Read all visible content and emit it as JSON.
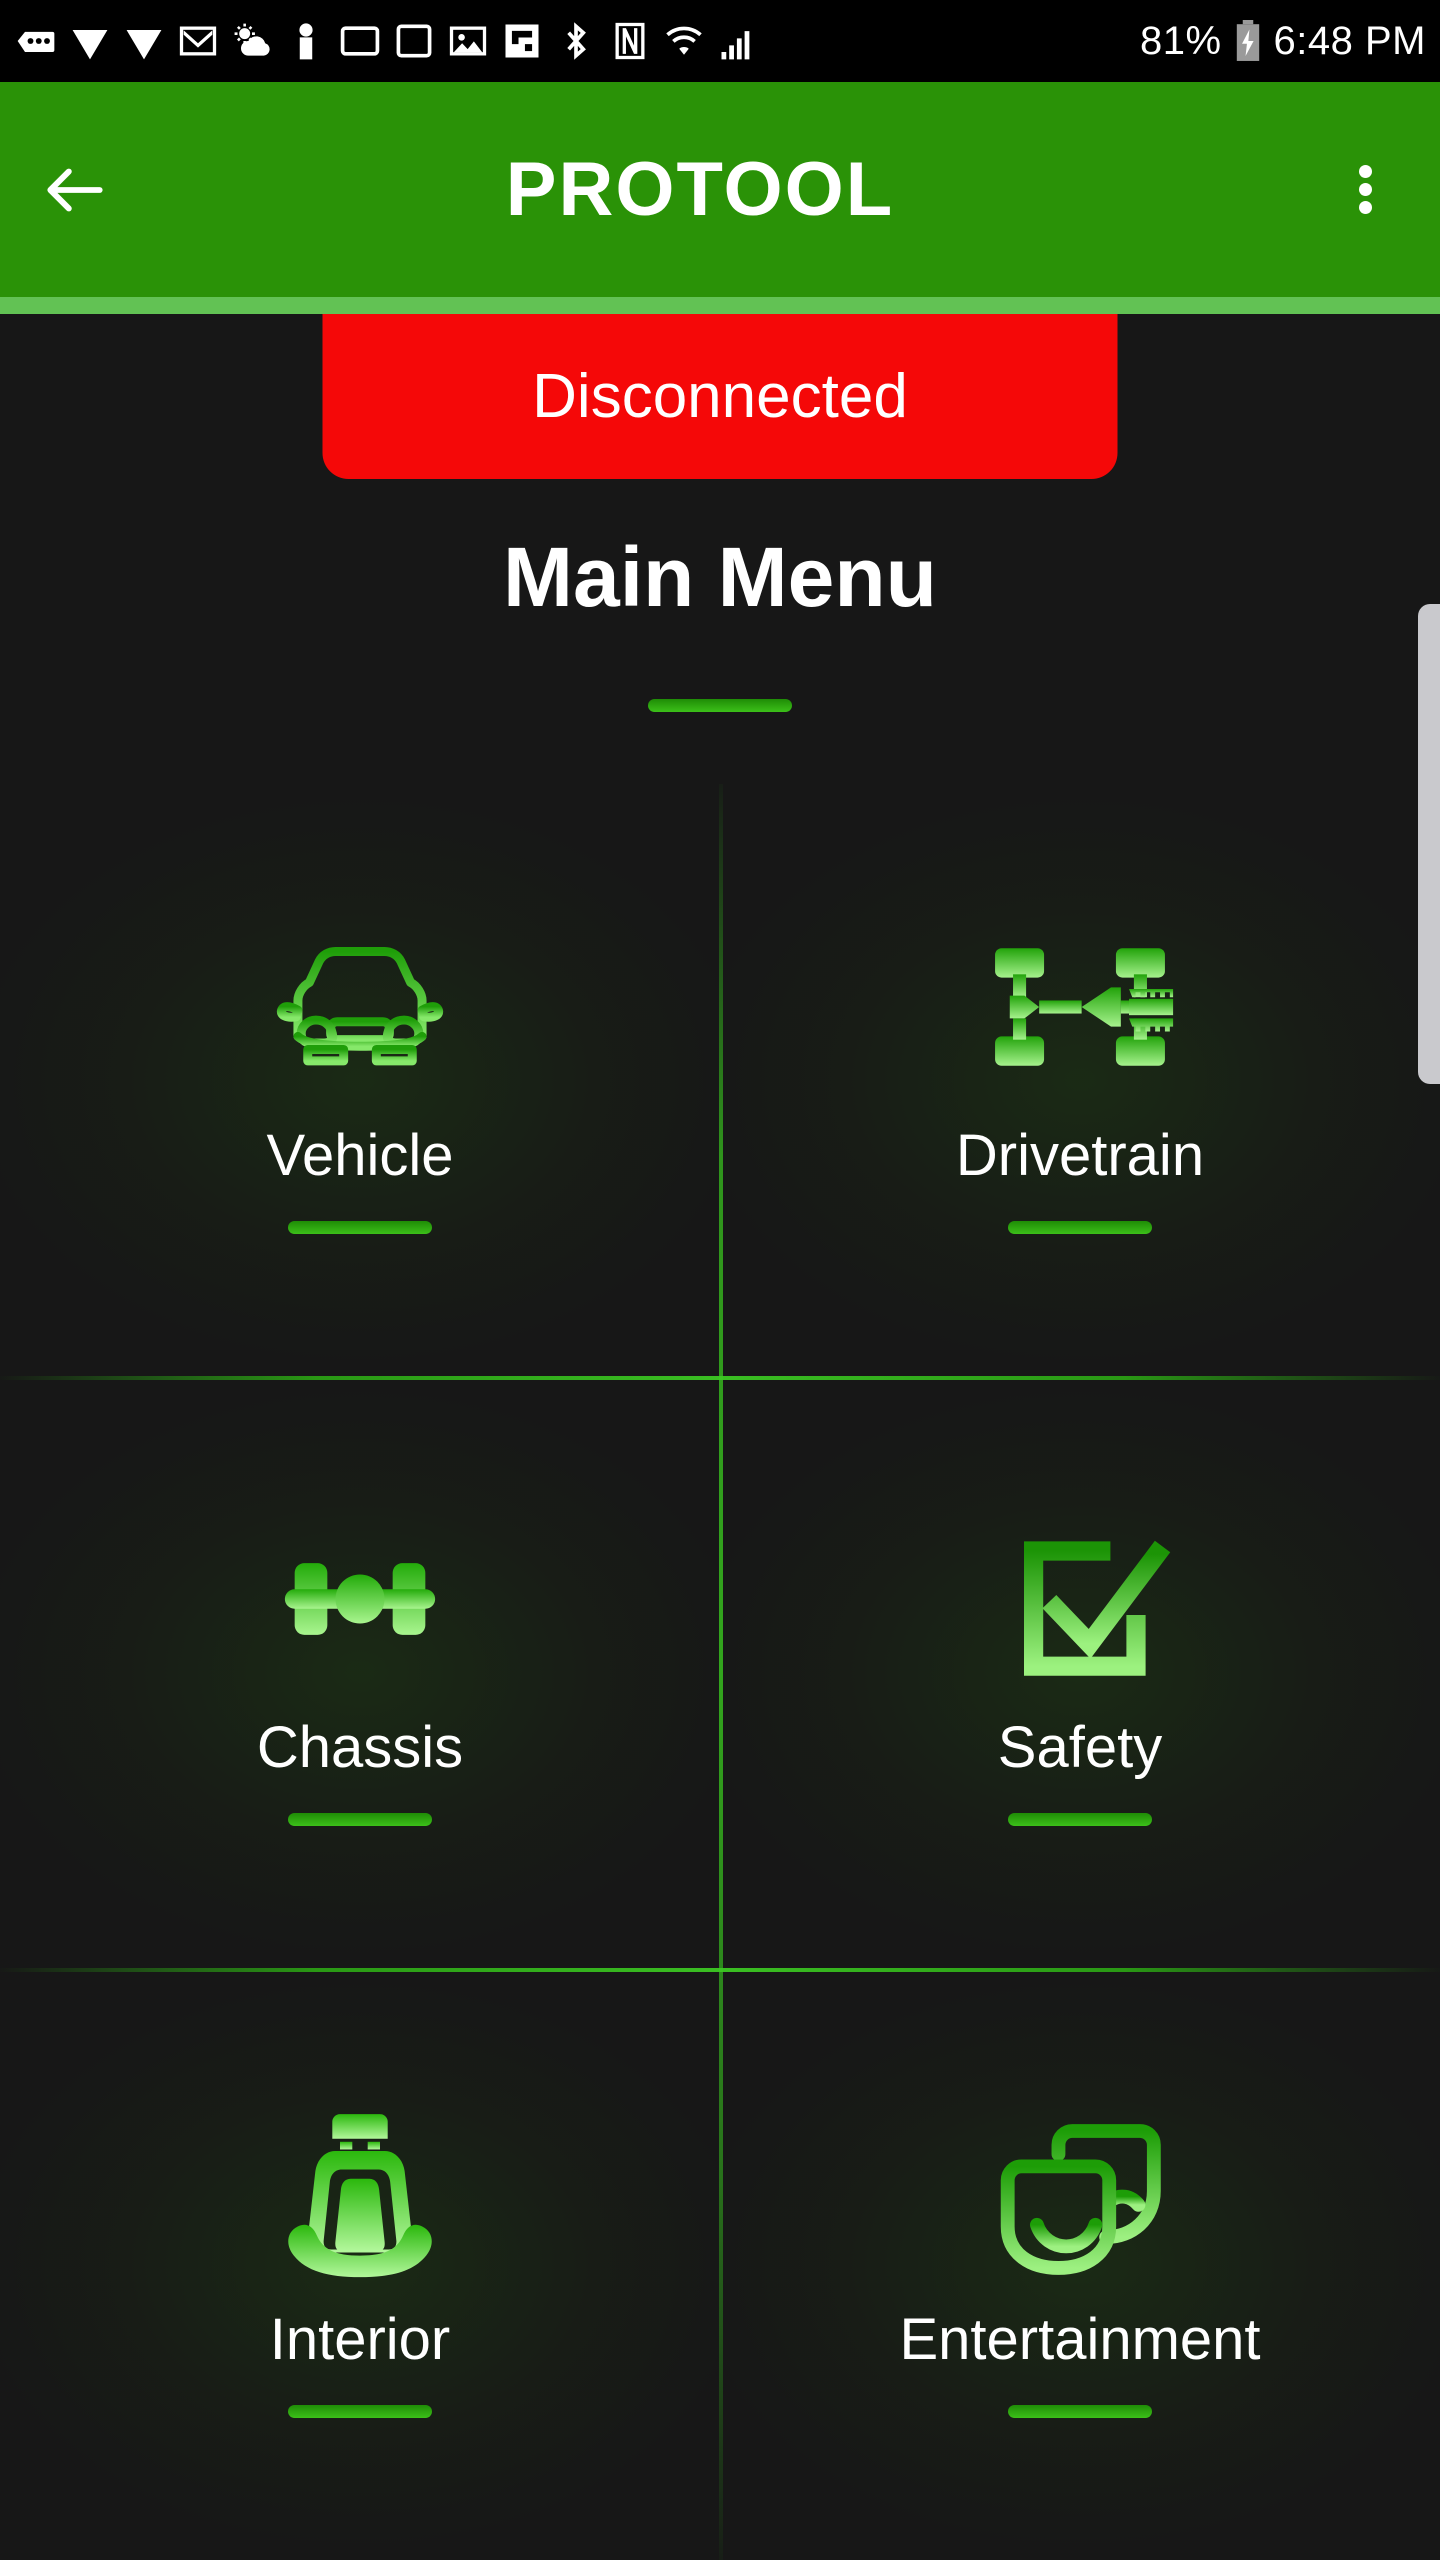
{
  "status_bar": {
    "battery_percent": "81%",
    "time": "6:48 PM",
    "left_icons": [
      "messages-dots-icon",
      "signal-waves-icon",
      "signal-waves-alt-icon",
      "gmail-icon",
      "weather-partly-cloudy-icon",
      "person-icon",
      "screen-icon",
      "screen-alt-icon",
      "photo-icon",
      "flipboard-icon",
      "bluetooth-icon",
      "nfc-icon",
      "wifi-icon",
      "cell-signal-icon"
    ],
    "battery_icon": "battery-charging-icon"
  },
  "app_bar": {
    "title": "PROTOOL",
    "back_icon": "back-arrow-icon",
    "overflow_icon": "overflow-menu-icon",
    "background_color": "#2a9207",
    "strip_color": "#62c254"
  },
  "connection": {
    "label": "Disconnected",
    "color": "#f50808"
  },
  "page": {
    "title": "Main Menu",
    "accent_color": "#3cc019"
  },
  "menu": {
    "items": [
      {
        "label": "Vehicle",
        "icon": "car-front-icon"
      },
      {
        "label": "Drivetrain",
        "icon": "drivetrain-axle-icon"
      },
      {
        "label": "Chassis",
        "icon": "chassis-axle-icon"
      },
      {
        "label": "Safety",
        "icon": "checkbox-check-icon"
      },
      {
        "label": "Interior",
        "icon": "car-seat-icon"
      },
      {
        "label": "Entertainment",
        "icon": "theater-masks-icon"
      }
    ]
  },
  "scrollbar": {
    "name": "vertical-scrollbar"
  }
}
